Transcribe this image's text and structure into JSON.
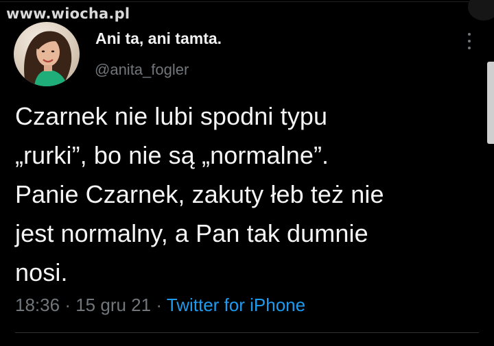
{
  "watermark": "www.wiocha.pl",
  "tweet": {
    "author": {
      "display_name": "Ani ta, ani tamta.",
      "handle": "@anita_fogler"
    },
    "text_lines": [
      "Czarnek nie lubi spodni typu",
      "„rurki”, bo nie są „normalne”.",
      "Panie Czarnek, zakuty łeb też nie",
      "jest normalny, a Pan tak dumnie",
      "nosi."
    ],
    "meta": {
      "time": "18:36",
      "separator": "·",
      "date": "15 gru 21",
      "source": "Twitter for iPhone"
    }
  },
  "icons": {
    "more": "more-vertical-icon",
    "avatar": "avatar"
  },
  "colors": {
    "background": "#000000",
    "text": "#f5f5f5",
    "muted": "#71767b",
    "link": "#1d9bf0"
  }
}
